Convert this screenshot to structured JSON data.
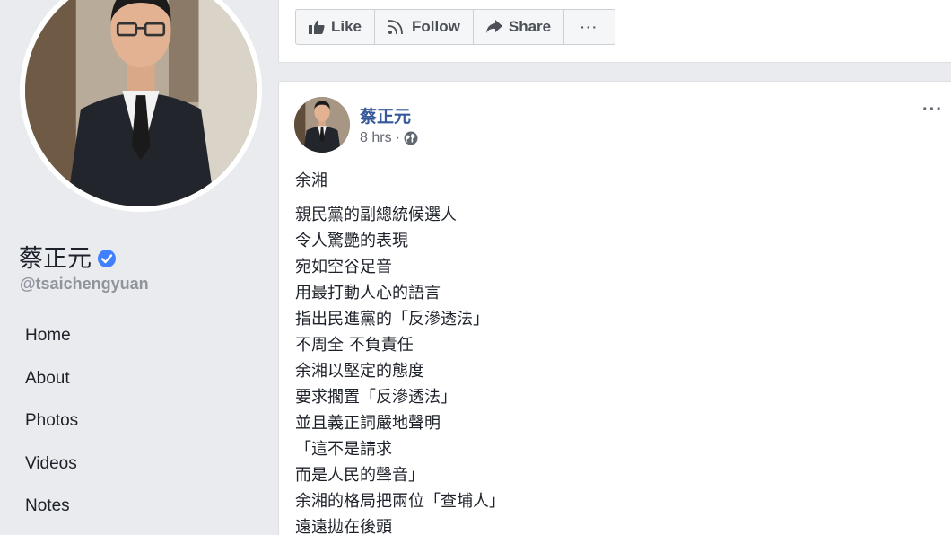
{
  "profile": {
    "name": "蔡正元",
    "handle": "@tsaichengyuan",
    "verified": true
  },
  "nav": {
    "items": [
      "Home",
      "About",
      "Photos",
      "Videos",
      "Notes"
    ]
  },
  "actions": {
    "like_label": "Like",
    "follow_label": "Follow",
    "share_label": "Share",
    "more_label": "···"
  },
  "post": {
    "author": "蔡正元",
    "time": "8 hrs",
    "separator": "·",
    "options_label": "···",
    "lines": [
      "余湘",
      "親民黨的副總統候選人",
      "令人驚艷的表現",
      "宛如空谷足音",
      "用最打動人心的語言",
      "指出民進黨的「反滲透法」",
      "不周全 不負責任",
      "余湘以堅定的態度",
      "要求擱置「反滲透法」",
      "並且義正詞嚴地聲明",
      "「這不是請求",
      "而是人民的聲音」",
      "余湘的格局把兩位「查埔人」",
      "遠遠拋在後頭"
    ]
  },
  "colors": {
    "background": "#e9ebee",
    "link": "#365899",
    "verified": "#4080ff"
  },
  "icons": {
    "like": "thumbs-up-icon",
    "follow": "rss-icon",
    "share": "share-arrow-icon",
    "globe": "globe-icon",
    "verified": "verified-check-icon"
  }
}
